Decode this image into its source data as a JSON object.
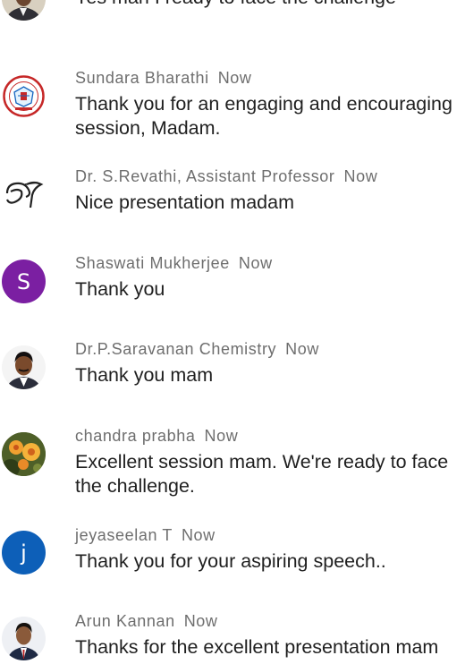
{
  "messages": [
    {
      "avatar": {
        "type": "photo",
        "icon": "man-portrait-avatar",
        "bg": "#cfc7b8"
      },
      "author": "",
      "time": "",
      "text": "Yes man I ready to face the challenge"
    },
    {
      "avatar": {
        "type": "photo",
        "icon": "college-emblem-avatar",
        "bg": "#ffffff"
      },
      "author": "Sundara Bharathi",
      "time": "Now",
      "text": "Thank you for an engaging and encouraging session, Madam."
    },
    {
      "avatar": {
        "type": "photo",
        "icon": "signature-logo-avatar",
        "bg": "#ffffff"
      },
      "author": "Dr. S.Revathi, Assistant Professor",
      "time": "Now",
      "text": "Nice presentation madam"
    },
    {
      "avatar": {
        "type": "letter",
        "letter": "S",
        "bg": "#7b1fa2"
      },
      "author": "Shaswati Mukherjee",
      "time": "Now",
      "text": "Thank you"
    },
    {
      "avatar": {
        "type": "photo",
        "icon": "man-portrait-avatar",
        "bg": "#ffffff"
      },
      "author": "Dr.P.Saravanan Chemistry",
      "time": "Now",
      "text": "Thank you mam"
    },
    {
      "avatar": {
        "type": "photo",
        "icon": "flowers-photo-avatar",
        "bg": "#5a6b2e"
      },
      "author": "chandra prabha",
      "time": "Now",
      "text": "Excellent session mam. We're ready to face the challenge."
    },
    {
      "avatar": {
        "type": "letter",
        "letter": "j",
        "bg": "#0d5fb8"
      },
      "author": "jeyaseelan T",
      "time": "Now",
      "text": "Thank you for your aspiring speech.."
    },
    {
      "avatar": {
        "type": "photo",
        "icon": "man-portrait-avatar",
        "bg": "#ffffff"
      },
      "author": "Arun Kannan",
      "time": "Now",
      "text": "Thanks for the excellent presentation mam"
    }
  ]
}
